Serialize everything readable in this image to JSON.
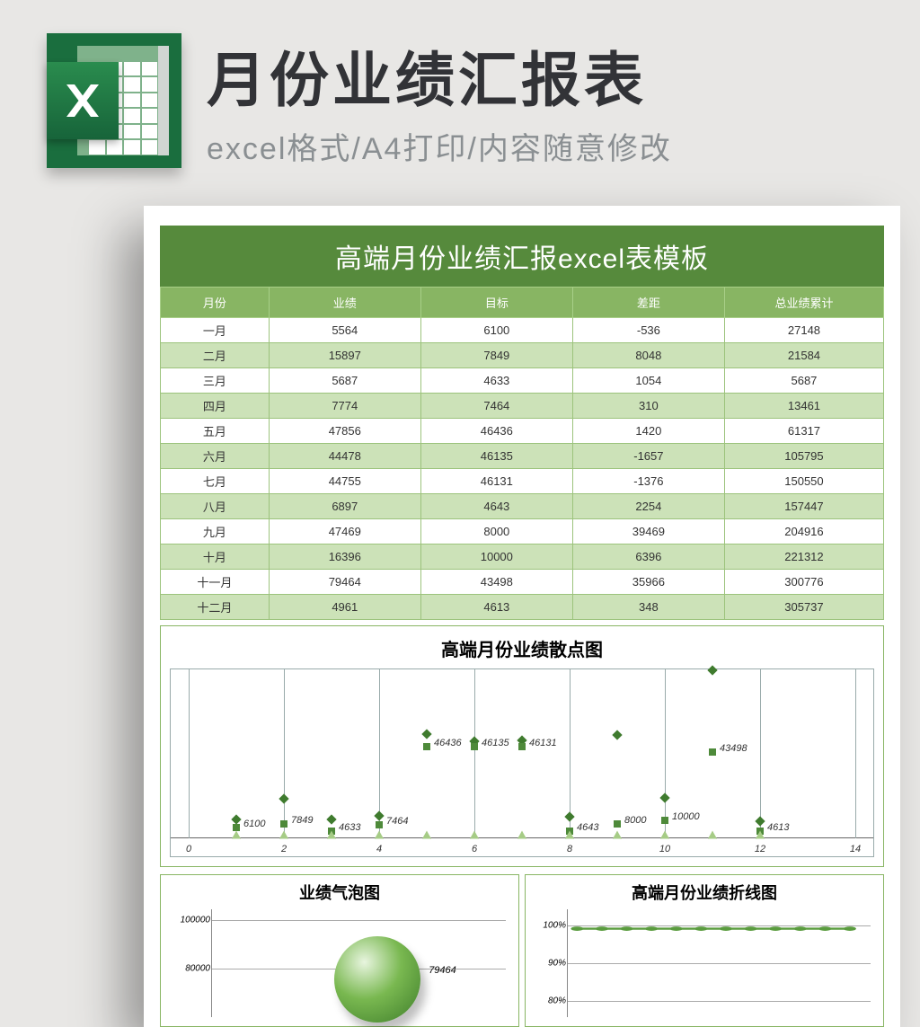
{
  "header": {
    "title": "月份业绩汇报表",
    "subtitle": "excel格式/A4打印/内容随意修改"
  },
  "doc_title": "高端月份业绩汇报excel表模板",
  "columns": [
    "月份",
    "业绩",
    "目标",
    "差距",
    "总业绩累计"
  ],
  "rows": [
    {
      "m": "一月",
      "a": "5564",
      "b": "6100",
      "c": "-536",
      "d": "27148"
    },
    {
      "m": "二月",
      "a": "15897",
      "b": "7849",
      "c": "8048",
      "d": "21584"
    },
    {
      "m": "三月",
      "a": "5687",
      "b": "4633",
      "c": "1054",
      "d": "5687"
    },
    {
      "m": "四月",
      "a": "7774",
      "b": "7464",
      "c": "310",
      "d": "13461"
    },
    {
      "m": "五月",
      "a": "47856",
      "b": "46436",
      "c": "1420",
      "d": "61317"
    },
    {
      "m": "六月",
      "a": "44478",
      "b": "46135",
      "c": "-1657",
      "d": "105795"
    },
    {
      "m": "七月",
      "a": "44755",
      "b": "46131",
      "c": "-1376",
      "d": "150550"
    },
    {
      "m": "八月",
      "a": "6897",
      "b": "4643",
      "c": "2254",
      "d": "157447"
    },
    {
      "m": "九月",
      "a": "47469",
      "b": "8000",
      "c": "39469",
      "d": "204916"
    },
    {
      "m": "十月",
      "a": "16396",
      "b": "10000",
      "c": "6396",
      "d": "221312"
    },
    {
      "m": "十一月",
      "a": "79464",
      "b": "43498",
      "c": "35966",
      "d": "300776"
    },
    {
      "m": "十二月",
      "a": "4961",
      "b": "4613",
      "c": "348",
      "d": "305737"
    }
  ],
  "scatter": {
    "title": "高端月份业绩散点图",
    "xticks": [
      "0",
      "2",
      "4",
      "6",
      "8",
      "10",
      "12",
      "14"
    ],
    "labels": [
      "6100",
      "7849",
      "4633",
      "7464",
      "46436",
      "46135",
      "46131",
      "4643",
      "8000",
      "10000",
      "43498",
      "4613"
    ]
  },
  "bubble": {
    "title": "业绩气泡图",
    "yticks": [
      "100000",
      "80000"
    ],
    "label": "79464"
  },
  "line": {
    "title": "高端月份业绩折线图",
    "yticks": [
      "100%",
      "90%",
      "80%"
    ]
  },
  "chart_data": [
    {
      "type": "scatter",
      "title": "高端月份业绩散点图",
      "x": [
        1,
        2,
        3,
        4,
        5,
        6,
        7,
        8,
        9,
        10,
        11,
        12
      ],
      "series": [
        {
          "name": "业绩",
          "values": [
            5564,
            15897,
            5687,
            7774,
            47856,
            44478,
            44755,
            6897,
            47469,
            16396,
            79464,
            4961
          ]
        },
        {
          "name": "目标",
          "values": [
            6100,
            7849,
            4633,
            7464,
            46436,
            46135,
            46131,
            4643,
            8000,
            10000,
            43498,
            4613
          ]
        }
      ],
      "xlim": [
        0,
        14
      ]
    },
    {
      "type": "scatter",
      "title": "业绩气泡图",
      "y_ticks": [
        80000,
        100000
      ],
      "values": [
        79464
      ]
    },
    {
      "type": "line",
      "title": "高端月份业绩折线图",
      "y_ticks_pct": [
        80,
        90,
        100
      ]
    }
  ]
}
